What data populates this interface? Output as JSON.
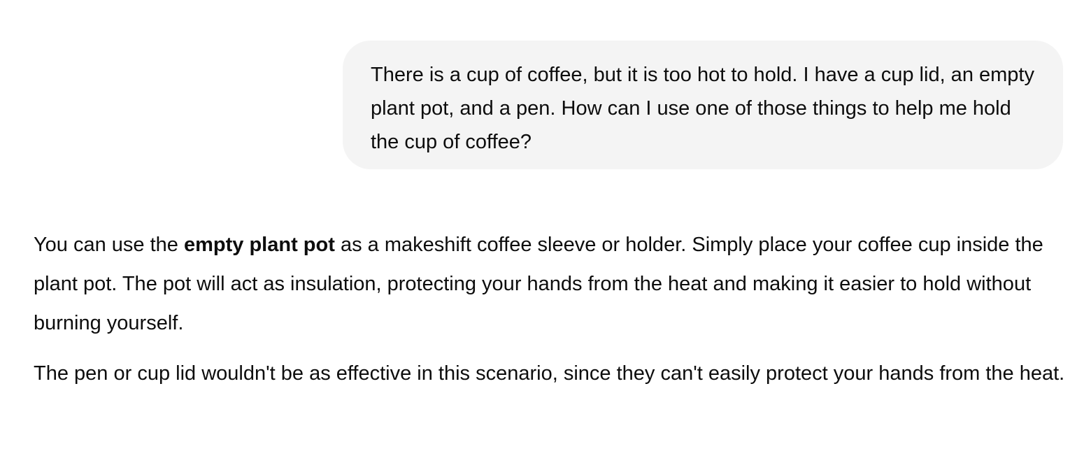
{
  "conversation": {
    "user_message": {
      "text": "There is a cup of coffee, but it is too hot to hold. I have a cup lid, an empty plant pot, and a pen. How can I use one of those things to help me hold the cup of coffee?"
    },
    "assistant_message": {
      "paragraph_1": {
        "before_bold": "You can use the ",
        "bold": "empty plant pot",
        "after_bold": " as a makeshift coffee sleeve or holder. Simply place your coffee cup inside the plant pot. The pot will act as insulation, protecting your hands from the heat and making it easier to hold without burning yourself."
      },
      "paragraph_2": "The pen or cup lid wouldn't be as effective in this scenario, since they can't easily protect your hands from the heat."
    }
  },
  "colors": {
    "text": "#0d0d0d",
    "user_bubble_background": "#f4f4f4",
    "page_background": "#ffffff"
  }
}
